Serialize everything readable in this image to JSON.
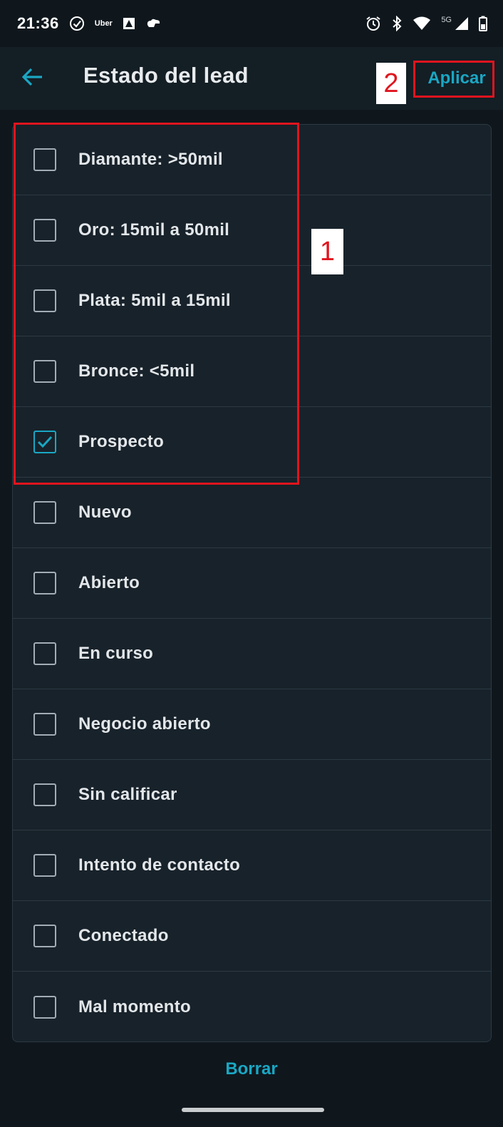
{
  "status_bar": {
    "time": "21:36",
    "uber_label": "Uber",
    "network_label": "5G",
    "icons": [
      "check-circle-icon",
      "uber-icon",
      "image-icon",
      "cloud-icon",
      "alarm-icon",
      "bluetooth-icon",
      "wifi-icon",
      "signal-icon",
      "battery-icon"
    ]
  },
  "app_bar": {
    "back_icon": "arrow-left-icon",
    "title": "Estado del lead",
    "apply_label": "Aplicar"
  },
  "annotations": {
    "box1_number": "1",
    "box2_number": "2",
    "color": "#e0141e"
  },
  "options": [
    {
      "label": "Diamante: >50mil",
      "checked": false
    },
    {
      "label": "Oro: 15mil a 50mil",
      "checked": false
    },
    {
      "label": "Plata: 5mil a 15mil",
      "checked": false
    },
    {
      "label": "Bronce: <5mil",
      "checked": false
    },
    {
      "label": "Prospecto",
      "checked": true
    },
    {
      "label": "Nuevo",
      "checked": false
    },
    {
      "label": "Abierto",
      "checked": false
    },
    {
      "label": "En curso",
      "checked": false
    },
    {
      "label": "Negocio abierto",
      "checked": false
    },
    {
      "label": "Sin calificar",
      "checked": false
    },
    {
      "label": "Intento de contacto",
      "checked": false
    },
    {
      "label": "Conectado",
      "checked": false
    },
    {
      "label": "Mal momento",
      "checked": false
    }
  ],
  "footer": {
    "clear_label": "Borrar"
  },
  "colors": {
    "accent": "#1aa7c4",
    "background": "#0f171d",
    "surface": "#18222a",
    "annotation": "#e0141e"
  }
}
